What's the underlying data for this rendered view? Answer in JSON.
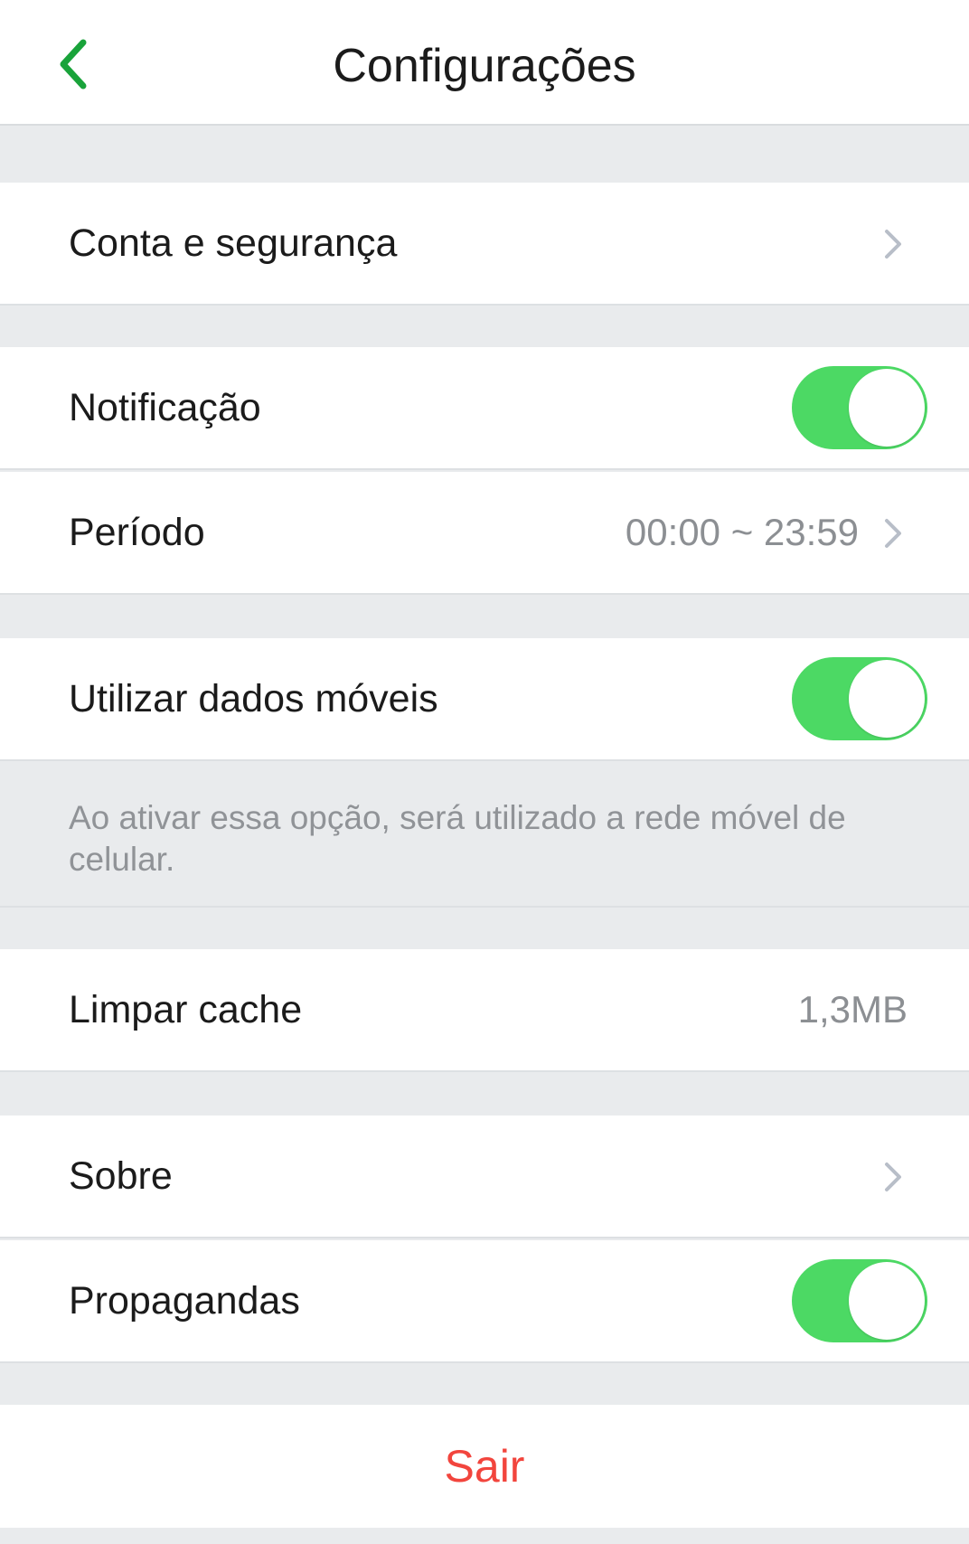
{
  "header": {
    "title": "Configurações",
    "back_icon": "chevron-left-icon",
    "accent_color": "#19a33a"
  },
  "rows": {
    "account": {
      "label": "Conta e segurança",
      "icon": "chevron-right-icon"
    },
    "notification": {
      "label": "Notificação",
      "enabled": true
    },
    "period": {
      "label": "Período",
      "value": "00:00 ~ 23:59",
      "icon": "chevron-right-icon"
    },
    "mobile_data": {
      "label": "Utilizar dados móveis",
      "enabled": true,
      "note": "Ao ativar essa opção, será utilizado a rede móvel de celular."
    },
    "cache": {
      "label": "Limpar cache",
      "value": "1,3MB"
    },
    "about": {
      "label": "Sobre",
      "icon": "chevron-right-icon"
    },
    "ads": {
      "label": "Propagandas",
      "enabled": true
    }
  },
  "logout": {
    "label": "Sair",
    "color": "#f2453d"
  },
  "toggle_color": "#4cd964"
}
